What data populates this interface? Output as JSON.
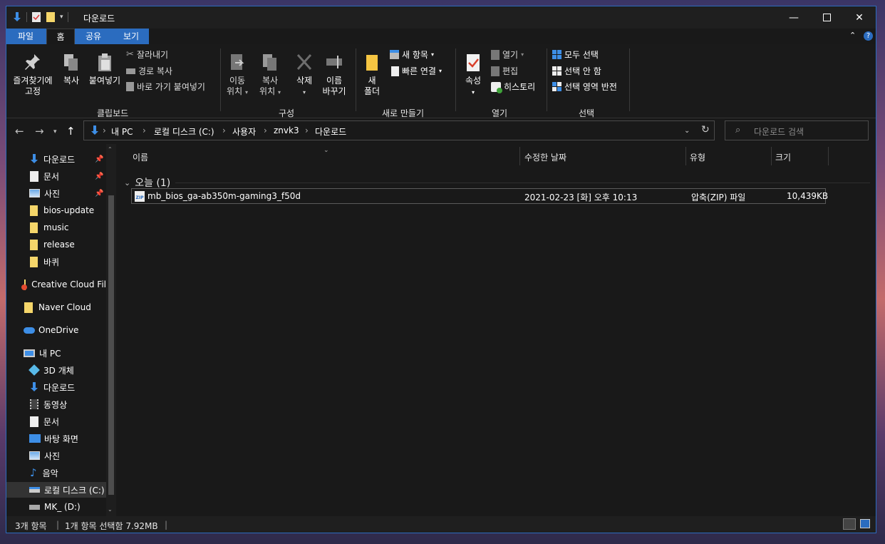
{
  "window": {
    "title": "다운로드"
  },
  "tabs": [
    "파일",
    "홈",
    "공유",
    "보기"
  ],
  "ribbon": {
    "pin": "즐겨찾기에\n고정",
    "copy": "복사",
    "paste": "붙여넣기",
    "cut": "잘라내기",
    "copy_path": "경로 복사",
    "paste_shortcut": "바로 가기 붙여넣기",
    "group_clipboard": "클립보드",
    "move_to": "이동\n위치",
    "copy_to": "복사\n위치",
    "delete": "삭제",
    "rename": "이름\n바꾸기",
    "group_organize": "구성",
    "new_folder": "새\n폴더",
    "new_item": "새 항목",
    "easy_access": "빠른 연결",
    "group_new": "새로 만들기",
    "properties": "속성",
    "open": "열기",
    "edit": "편집",
    "history": "히스토리",
    "group_open": "열기",
    "select_all": "모두 선택",
    "select_none": "선택 안 함",
    "invert_selection": "선택 영역 반전",
    "group_select": "선택"
  },
  "address": {
    "crumbs": [
      "내 PC",
      "로컬 디스크 (C:)",
      "사용자",
      "znvk3",
      "다운로드"
    ],
    "search_placeholder": "다운로드 검색"
  },
  "sidebar": {
    "items": [
      {
        "label": "다운로드",
        "icon": "download-arrow-icon",
        "pinned": true
      },
      {
        "label": "문서",
        "icon": "document-icon",
        "pinned": true
      },
      {
        "label": "사진",
        "icon": "picture-icon",
        "pinned": true
      },
      {
        "label": "bios-update",
        "icon": "folder-icon",
        "pinned": false
      },
      {
        "label": "music",
        "icon": "folder-icon",
        "pinned": false
      },
      {
        "label": "release",
        "icon": "folder-icon",
        "pinned": false
      },
      {
        "label": "바퀴",
        "icon": "folder-icon",
        "pinned": false
      },
      {
        "label": "Creative Cloud Fil",
        "icon": "creative-cloud-folder-icon",
        "pinned": false
      },
      {
        "label": "Naver Cloud",
        "icon": "folder-icon",
        "pinned": false
      },
      {
        "label": "OneDrive",
        "icon": "cloud-icon",
        "pinned": false
      },
      {
        "label": "내 PC",
        "icon": "computer-icon",
        "pinned": false
      },
      {
        "label": "3D 개체",
        "icon": "cube-icon",
        "pinned": false
      },
      {
        "label": "다운로드",
        "icon": "download-arrow-icon",
        "pinned": false
      },
      {
        "label": "동영상",
        "icon": "video-icon",
        "pinned": false
      },
      {
        "label": "문서",
        "icon": "document-icon",
        "pinned": false
      },
      {
        "label": "바탕 화면",
        "icon": "desktop-icon",
        "pinned": false
      },
      {
        "label": "사진",
        "icon": "picture-icon",
        "pinned": false
      },
      {
        "label": "음악",
        "icon": "music-note-icon",
        "pinned": false
      },
      {
        "label": "로컬 디스크 (C:)",
        "icon": "drive-icon",
        "pinned": false
      },
      {
        "label": "MK_ (D:)",
        "icon": "drive-icon",
        "pinned": false
      }
    ]
  },
  "columns": {
    "name": "이름",
    "date": "수정한 날짜",
    "type": "유형",
    "size": "크기"
  },
  "group": {
    "label": "오늘 (1)"
  },
  "files": [
    {
      "name": "mb_bios_ga-ab350m-gaming3_f50d",
      "date": "2021-02-23 [화] 오후 10:13",
      "type": "압축(ZIP) 파일",
      "size": "10,439KB"
    }
  ],
  "status": {
    "count": "3개 항목",
    "selected": "1개 항목 선택함 7.92MB"
  },
  "colors": {
    "accent": "#2b6cbf",
    "background": "#191919"
  }
}
